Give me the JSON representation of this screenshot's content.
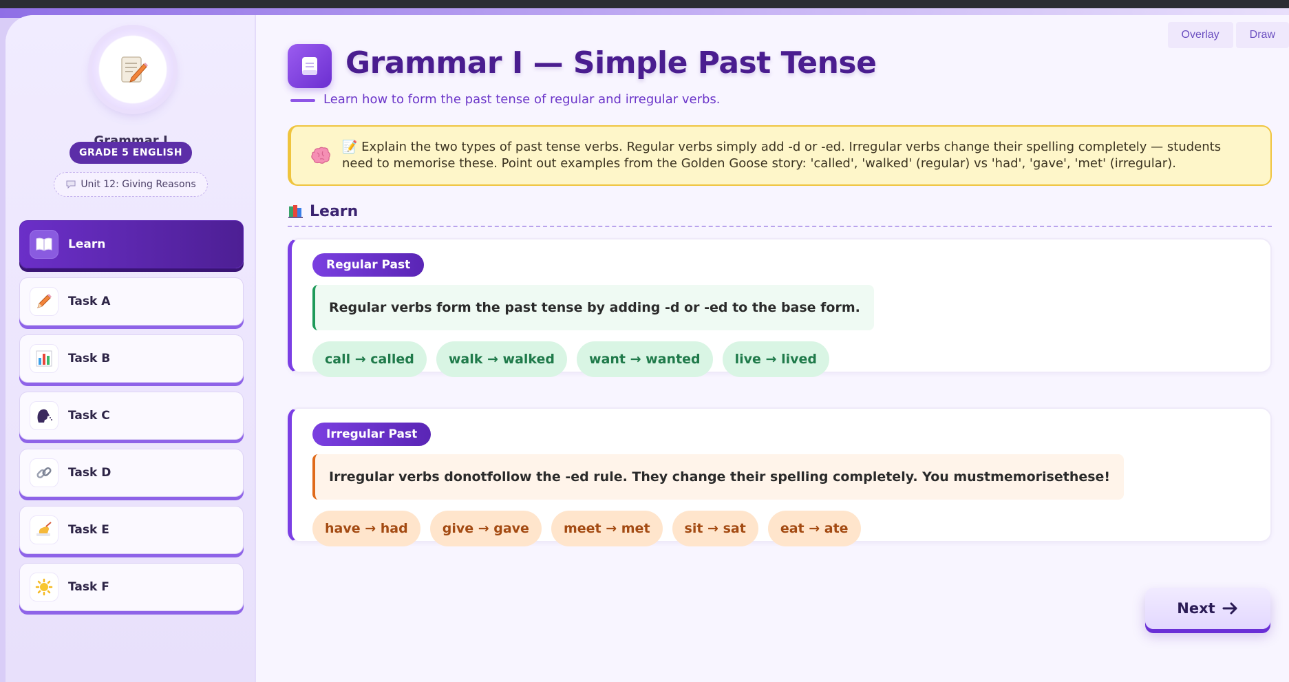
{
  "window": {
    "overlay_label": "Overlay",
    "draw_label": "Draw"
  },
  "sidebar": {
    "title": "Grammar I",
    "grade": "GRADE 5 ENGLISH",
    "unit": "Unit 12: Giving Reasons",
    "items": [
      {
        "label": "Learn",
        "icon": "book-icon",
        "active": true
      },
      {
        "label": "Task A",
        "icon": "pencil-icon",
        "active": false
      },
      {
        "label": "Task B",
        "icon": "bar-chart-icon",
        "active": false
      },
      {
        "label": "Task C",
        "icon": "speaking-head-icon",
        "active": false
      },
      {
        "label": "Task D",
        "icon": "link-icon",
        "active": false
      },
      {
        "label": "Task E",
        "icon": "writing-hand-icon",
        "active": false
      },
      {
        "label": "Task F",
        "icon": "sun-icon",
        "active": false
      }
    ]
  },
  "main": {
    "title": "Grammar I — Simple Past Tense",
    "subtitle": "Learn how to form the past tense of regular and irregular verbs.",
    "teacher_note": {
      "line1": "📝 Explain the two types of past tense verbs. Regular verbs simply add -d or -ed. Irregular verbs change their spelling completely — students",
      "line2": "need to memorise these. Point out examples from the Golden Goose story: 'called', 'walked' (regular) vs 'had', 'gave', 'met' (irregular)."
    },
    "section_title": "Learn",
    "regular": {
      "tag": "Regular Past",
      "rule": "Regular verbs form the past tense by adding -d or -ed to the base form.",
      "examples": [
        "call → called",
        "walk → walked",
        "want → wanted",
        "live → lived"
      ]
    },
    "irregular": {
      "tag": "Irregular Past",
      "rule_parts": [
        "Irregular verbs do ",
        "not",
        " follow the -ed rule. They change their spelling completely. You must ",
        "memorise",
        " these!"
      ],
      "examples": [
        "have → had",
        "give → gave",
        "meet → met",
        "sit → sat",
        "eat → ate"
      ]
    },
    "next_label": "Next"
  },
  "colors": {
    "accent": "#6b2fc8",
    "title": "#4a1d8f",
    "regular_green": "#1f7a4a",
    "irregular_orange": "#a34a12",
    "note_border": "#efc43e"
  }
}
